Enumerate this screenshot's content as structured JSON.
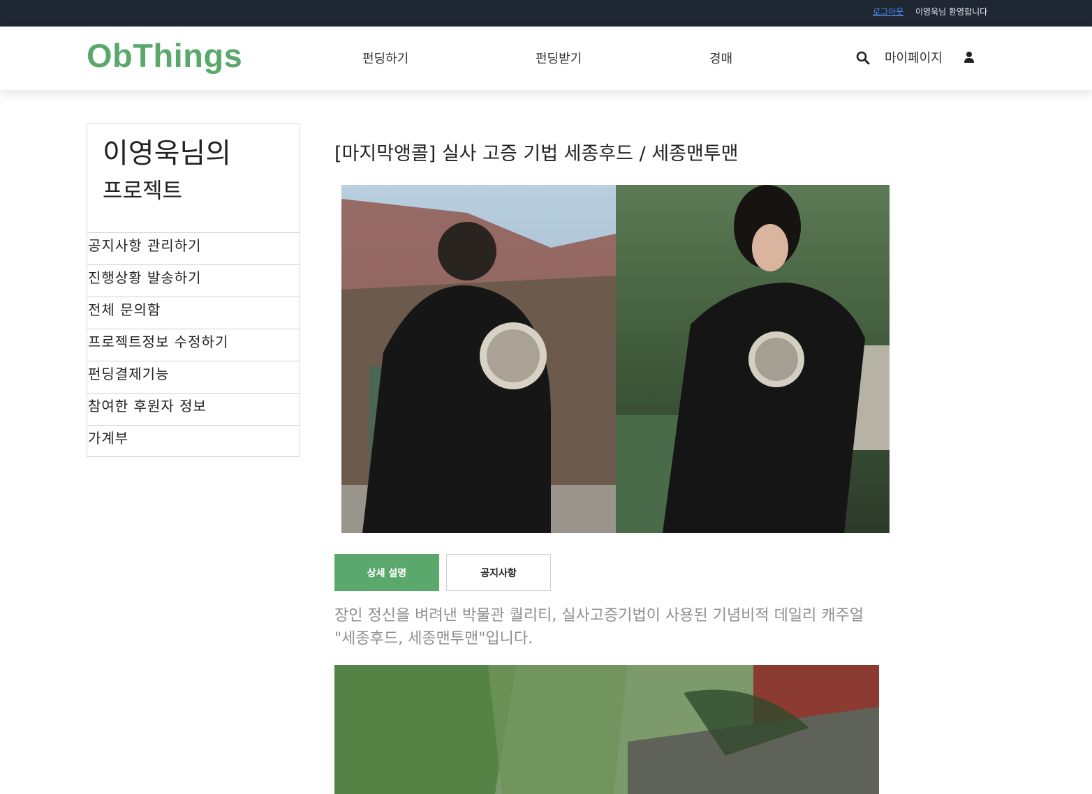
{
  "topbar": {
    "logout_label": "로그아웃",
    "welcome_text": "이영욱님 환영합니다"
  },
  "header": {
    "logo": "ObThings",
    "nav": {
      "funding": "펀딩하기",
      "receive": "펀딩받기",
      "auction": "경매"
    },
    "mypage": "마이페이지",
    "search_icon": "search-icon",
    "user_icon": "user-icon"
  },
  "sidebar": {
    "title": "이영욱님의",
    "subtitle": "프로젝트",
    "items": [
      {
        "label": "공지사항 관리하기"
      },
      {
        "label": "진행상황 발송하기"
      },
      {
        "label": "전체 문의함"
      },
      {
        "label": "프로젝트정보 수정하기"
      },
      {
        "label": "펀딩결제기능"
      },
      {
        "label": "참여한 후원자 정보"
      },
      {
        "label": "가계부"
      }
    ]
  },
  "main": {
    "title": "[마지막앵콜] 실사 고증 기법 세종후드 / 세종맨투맨",
    "tabs": {
      "detail": "상세 설명",
      "notice": "공지사항"
    },
    "description": "장인 정신을 벼려낸 박물관 퀄리티, 실사고증기법이 사용된 기념비적 데일리 캐주얼 \"세종후드, 세종맨투맨\"입니다."
  },
  "colors": {
    "brand_green": "#5aa86c",
    "topbar_bg": "#1f2733",
    "link_blue": "#4a8cf0",
    "desc_gray": "#8f8f8f"
  }
}
